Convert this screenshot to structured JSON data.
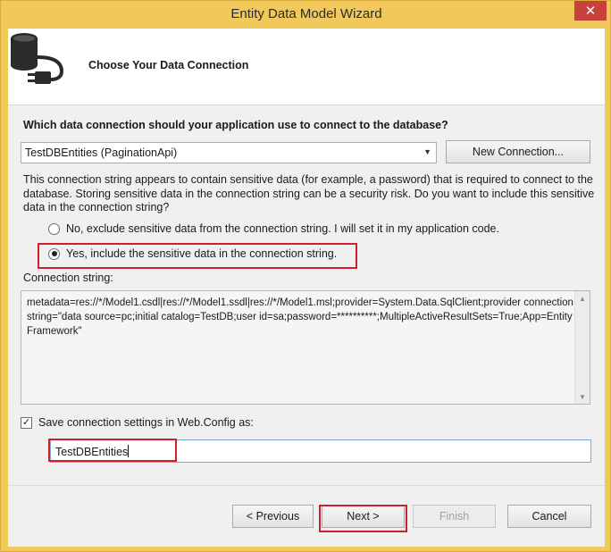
{
  "window": {
    "title": "Entity Data Model Wizard",
    "close_glyph": "✕"
  },
  "header": {
    "title": "Choose Your Data Connection",
    "icon": "database-plug-icon"
  },
  "main": {
    "question": "Which data connection should your application use to connect to the database?",
    "connection_select_value": "TestDBEntities (PaginationApi)",
    "dropdown_glyph": "▼",
    "new_connection_label": "New Connection...",
    "warning_text": "This connection string appears to contain sensitive data (for example, a password) that is required to connect to the database. Storing sensitive data in the connection string can be a security risk. Do you want to include this sensitive data in the connection string?",
    "radio_no_label": "No, exclude sensitive data from the connection string. I will set it in my application code.",
    "radio_yes_label": "Yes, include the sensitive data in the connection string.",
    "selected_radio": "yes",
    "connection_string_label": "Connection string:",
    "connection_string_value": "metadata=res://*/Model1.csdl|res://*/Model1.ssdl|res://*/Model1.msl;provider=System.Data.SqlClient;provider connection string=\"data source=pc;initial catalog=TestDB;user id=sa;password=**********;MultipleActiveResultSets=True;App=EntityFramework\"",
    "scroll_up_glyph": "▲",
    "scroll_down_glyph": "▼",
    "save_checkbox_label": "Save connection settings in Web.Config as:",
    "save_checked": true,
    "check_glyph": "✓",
    "entity_name_value": "TestDBEntities"
  },
  "footer": {
    "previous_label": "< Previous",
    "next_label": "Next >",
    "finish_label": "Finish",
    "cancel_label": "Cancel"
  },
  "colors": {
    "title_bar": "#f0c95a",
    "close_button": "#c7423a",
    "highlight_border": "#d11e2b",
    "dialog_background": "#f0f0f0"
  }
}
